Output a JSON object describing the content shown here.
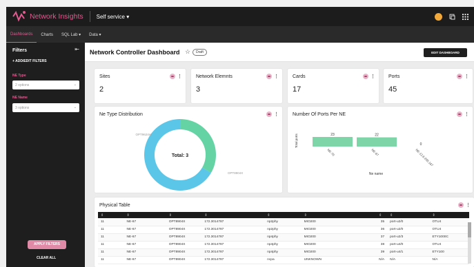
{
  "topbar": {
    "brand": "Network Insights",
    "menu": "Self service",
    "menu_chevron": "▾"
  },
  "subnav": {
    "tabs": [
      "Dashboards",
      "Charts",
      "SQL Lab ▾",
      "Data ▾"
    ]
  },
  "sidebar": {
    "title": "Filters",
    "add_filter": "+ ADD/EDIT FILTERS",
    "filters": [
      {
        "label": "NE Type",
        "placeholder": "2 options"
      },
      {
        "label": "NE Name",
        "placeholder": "3 options"
      }
    ],
    "apply": "APPLY FILTERS",
    "clear": "CLEAR ALL"
  },
  "dashboard": {
    "title": "Network Controller Dashboard",
    "badge": "Draft",
    "edit": "EDIT DASHBOARD"
  },
  "cards": [
    {
      "title": "Sites",
      "value": "2"
    },
    {
      "title": "Network Elemnts",
      "value": "3"
    },
    {
      "title": "Cards",
      "value": "17"
    },
    {
      "title": "Ports",
      "value": "45"
    }
  ],
  "donut": {
    "title": "Ne Type Distribution",
    "center": "Total: 3",
    "colors": [
      "#65d3a4",
      "#5bc6e8"
    ],
    "chart_data": {
      "type": "pie",
      "categories": [
        "OPT9624H",
        "OPT8904X"
      ],
      "values": [
        1,
        2
      ]
    }
  },
  "ports_chart": {
    "title": "Number Of Ports Per NE",
    "chart_data": {
      "type": "bar",
      "categories": [
        "NE-70",
        "NE-67",
        "NE-12.6.205.167"
      ],
      "values": [
        23,
        22,
        0
      ],
      "ylabel": "Total ports",
      "xlabel": "Ne name",
      "color": "#7ed6a8"
    }
  },
  "physical_table": {
    "title": "Physical Table",
    "rows": [
      [
        "11",
        "NE-67",
        "OPT8904X",
        "172.3014787",
        "np2phy",
        "MIO200",
        "35",
        "port-u2/0",
        "OTU4"
      ],
      [
        "11",
        "NE-67",
        "OPT8904X",
        "172.3014787",
        "np2phy",
        "MIO200",
        "36",
        "port-u2/0",
        "OTU4"
      ],
      [
        "11",
        "NE-67",
        "OPT8904X",
        "172.3014787",
        "np4phy",
        "MIO200",
        "37",
        "port-u2/3",
        "ETY1000C"
      ],
      [
        "11",
        "NE-67",
        "OPT8904X",
        "172.3014787",
        "np4phy",
        "MIO200",
        "38",
        "port-u4/0",
        "OTU4"
      ],
      [
        "11",
        "NE-67",
        "OPT8904X",
        "172.3014787",
        "np4phy",
        "MIO200",
        "39",
        "port-u4/1",
        "ETY100"
      ],
      [
        "11",
        "NE-67",
        "OPT8904X",
        "172.3014787",
        "ncpa",
        "UNKNOWN",
        "N/A",
        "N/A",
        "N/A"
      ]
    ]
  }
}
